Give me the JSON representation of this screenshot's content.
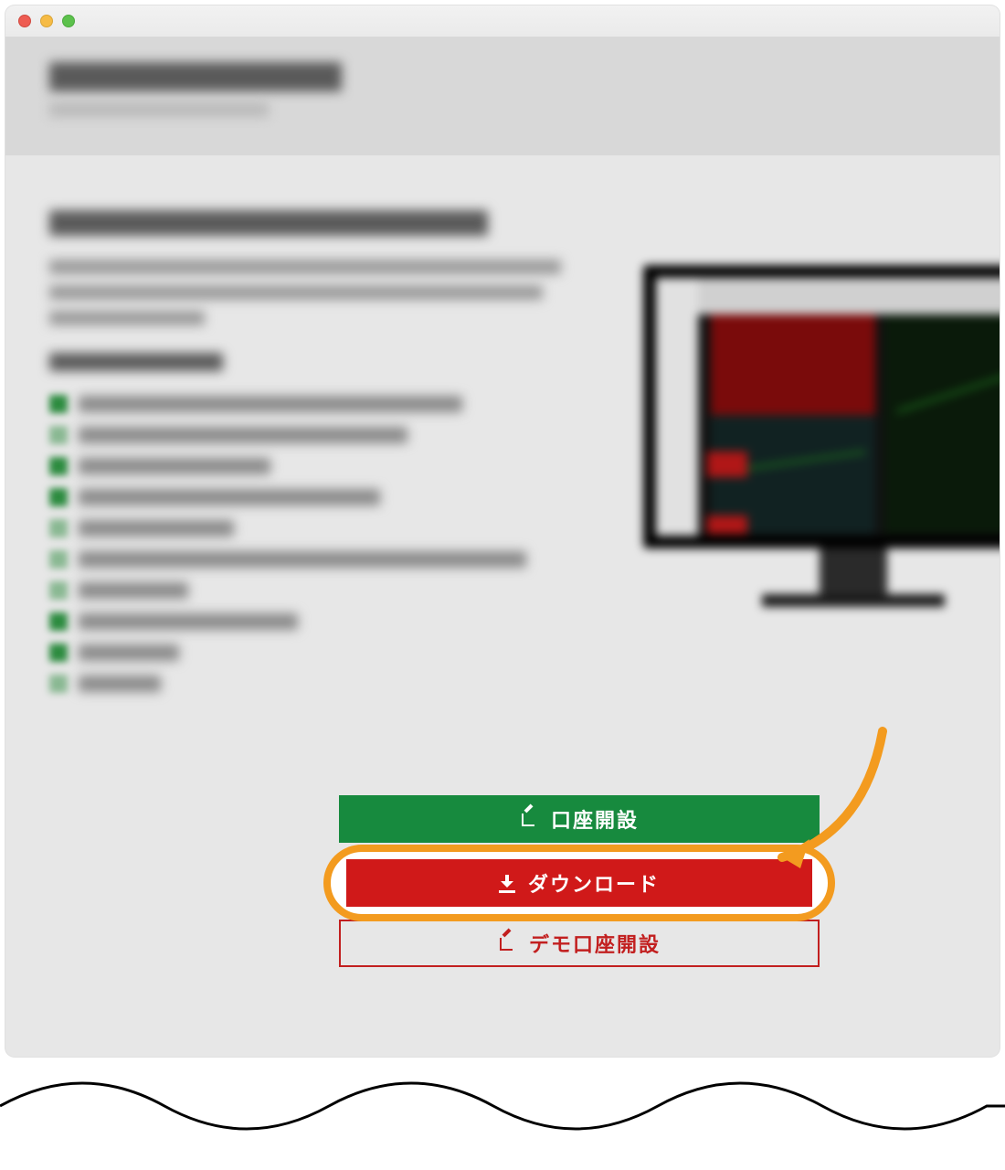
{
  "buttons": {
    "open_account": "口座開設",
    "download": "ダウンロード",
    "demo_account": "デモ口座開設"
  },
  "colors": {
    "green": "#178a3e",
    "red": "#d01919",
    "highlight_orange": "#f39b1f",
    "outline_red": "#c21f1f"
  }
}
